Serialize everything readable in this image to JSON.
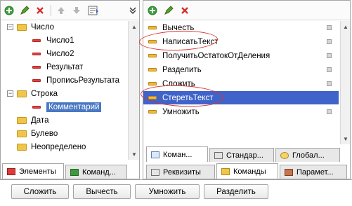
{
  "left_tree": {
    "items": [
      {
        "label": "Число",
        "kind": "folder",
        "expanded": true
      },
      {
        "label": "Число1",
        "kind": "attr"
      },
      {
        "label": "Число2",
        "kind": "attr"
      },
      {
        "label": "Результат",
        "kind": "attr"
      },
      {
        "label": "ПрописьРезультата",
        "kind": "attr"
      },
      {
        "label": "Строка",
        "kind": "folder",
        "expanded": true
      },
      {
        "label": "Комментарий",
        "kind": "attr",
        "selected": true
      },
      {
        "label": "Дата",
        "kind": "folder"
      },
      {
        "label": "Булево",
        "kind": "folder"
      },
      {
        "label": "Неопределено",
        "kind": "folder"
      }
    ]
  },
  "left_tabs": [
    {
      "label": "Элементы",
      "active": true
    },
    {
      "label": "Команд..."
    }
  ],
  "methods_list": {
    "items": [
      {
        "label": "Вычесть"
      },
      {
        "label": "НаписатьТекст",
        "circled": true
      },
      {
        "label": "ПолучитьОстатокОтДеления"
      },
      {
        "label": "Разделить"
      },
      {
        "label": "Сложить"
      },
      {
        "label": "СтеретьТекст",
        "selected": true,
        "circled": true
      },
      {
        "label": "Умножить"
      }
    ]
  },
  "inner_tabs": [
    {
      "label": "Коман...",
      "active": true
    },
    {
      "label": "Стандар..."
    },
    {
      "label": "Глобал..."
    }
  ],
  "right_tabs": [
    {
      "label": "Реквизиты"
    },
    {
      "label": "Команды",
      "active": true
    },
    {
      "label": "Парамет..."
    }
  ],
  "form_buttons": [
    {
      "label": "Сложить"
    },
    {
      "label": "Вычесть"
    },
    {
      "label": "Умножить"
    },
    {
      "label": "Разделить"
    }
  ],
  "colors": {
    "selection": "#3f63c9",
    "annotation": "#e03030"
  }
}
